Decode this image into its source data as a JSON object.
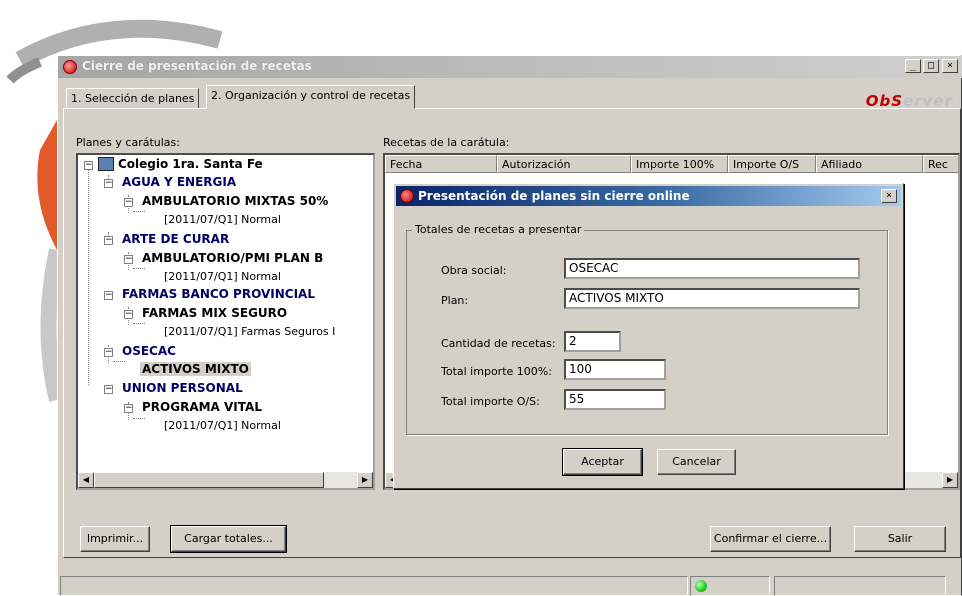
{
  "window": {
    "title": "Cierre de presentación de recetas",
    "minimize": "_",
    "maximize": "□",
    "close": "×"
  },
  "tabs": [
    {
      "label": "1. Selección de planes"
    },
    {
      "label": "2. Organización y control de recetas"
    }
  ],
  "brand": {
    "part1": "ObS",
    "part2": "erver"
  },
  "planes": {
    "label": "Planes y carátulas:",
    "tree": [
      {
        "text": "Colegio 1ra. Santa Fe"
      },
      {
        "text": "AGUA Y ENERGIA"
      },
      {
        "text": "AMBULATORIO MIXTAS 50%"
      },
      {
        "text": "[2011/07/Q1] Normal"
      },
      {
        "text": "ARTE DE CURAR"
      },
      {
        "text": "AMBULATORIO/PMI PLAN B"
      },
      {
        "text": "[2011/07/Q1] Normal"
      },
      {
        "text": "FARMAS BANCO PROVINCIAL"
      },
      {
        "text": "FARMAS MIX SEGURO"
      },
      {
        "text": "[2011/07/Q1] Farmas Seguros I"
      },
      {
        "text": "OSECAC"
      },
      {
        "text": "ACTIVOS MIXTO"
      },
      {
        "text": "UNION PERSONAL"
      },
      {
        "text": "PROGRAMA VITAL"
      },
      {
        "text": "[2011/07/Q1] Normal"
      }
    ]
  },
  "recetas": {
    "label": "Recetas de la carátula:",
    "columns": [
      "Fecha",
      "Autorización",
      "Importe 100%",
      "Importe O/S",
      "Afiliado",
      "Rec"
    ]
  },
  "buttons": {
    "imprimir": "Imprimir...",
    "cargar": "Cargar totales...",
    "confirmar": "Confirmar el cierre...",
    "salir": "Salir"
  },
  "dialog": {
    "title": "Presentación de planes sin cierre online",
    "close": "×",
    "group_label": "Totales de recetas a presentar",
    "obra_social_label": "Obra social:",
    "obra_social_value": "OSECAC",
    "plan_label": "Plan:",
    "plan_value": "ACTIVOS MIXTO",
    "cantidad_label": "Cantidad de recetas:",
    "cantidad_value": "2",
    "total100_label": "Total importe 100%:",
    "total100_value": "100",
    "totalos_label": "Total importe O/S:",
    "totalos_value": "55",
    "aceptar": "Aceptar",
    "cancelar": "Cancelar"
  },
  "colors": {
    "tree_blue": "#000066",
    "dialog_title": "#0a246a",
    "brand_red": "#c00000",
    "status_led": "#22cc22"
  }
}
